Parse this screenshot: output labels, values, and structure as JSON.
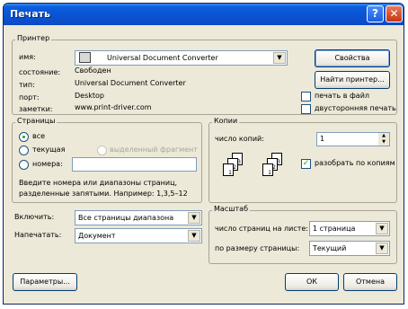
{
  "window": {
    "title": "Печать",
    "help_btn": "?",
    "close_btn": "✕"
  },
  "printer": {
    "legend": "Принтер",
    "name_label": "имя:",
    "name_value": "Universal Document Converter",
    "status_label": "состояние:",
    "status_value": "Свободен",
    "type_label": "тип:",
    "type_value": "Universal Document Converter",
    "port_label": "порт:",
    "port_value": "Desktop",
    "notes_label": "заметки:",
    "notes_value": "www.print-driver.com",
    "properties_btn": "Свойства",
    "find_btn": "Найти принтер...",
    "print_to_file": "печать в файл",
    "duplex": "двусторонняя печать"
  },
  "pages": {
    "legend": "Страницы",
    "all": "все",
    "current": "текущая",
    "selection": "выделенный фрагмент",
    "numbers": "номера:",
    "hint_line1": "Введите номера или диапазоны страниц,",
    "hint_line2": "разделенные запятыми. Например: 1,3,5–12"
  },
  "copies": {
    "legend": "Копии",
    "count_label": "число копий:",
    "count_value": "1",
    "collate": "разобрать по копиям",
    "pages_a": [
      "3",
      "2",
      "1"
    ],
    "pages_b": [
      "3",
      "2",
      "1"
    ]
  },
  "include": {
    "label": "Включить:",
    "value": "Все страницы диапазона"
  },
  "print_what": {
    "label": "Напечатать:",
    "value": "Документ"
  },
  "zoom": {
    "legend": "Масштаб",
    "per_sheet_label": "число страниц на листе:",
    "per_sheet_value": "1 страница",
    "scale_label": "по размеру страницы:",
    "scale_value": "Текущий"
  },
  "footer": {
    "options_btn": "Параметры...",
    "ok_btn": "ОК",
    "cancel_btn": "Отмена"
  },
  "icons": {
    "dropdown": "▼",
    "spin_up": "▲",
    "spin_down": "▼",
    "check": "✓"
  }
}
